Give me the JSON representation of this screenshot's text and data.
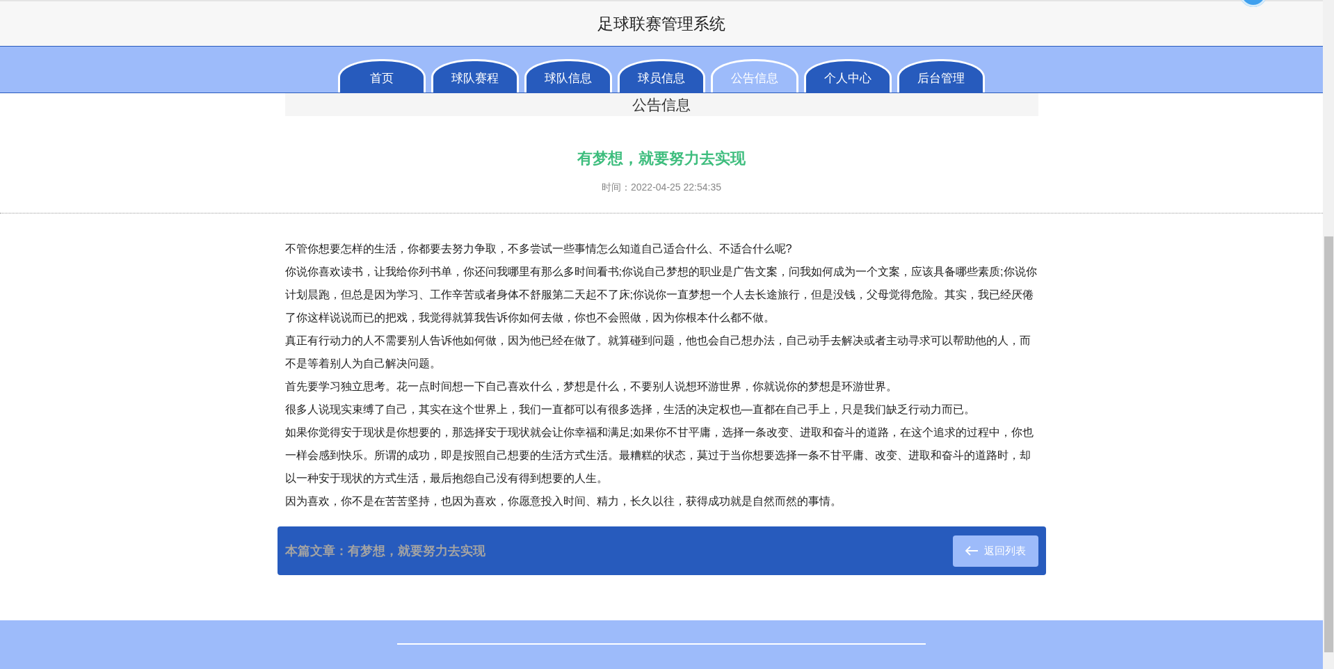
{
  "header": {
    "title": "足球联赛管理系统"
  },
  "nav": {
    "tabs": [
      {
        "label": "首页",
        "selected": false
      },
      {
        "label": "球队赛程",
        "selected": false
      },
      {
        "label": "球队信息",
        "selected": false
      },
      {
        "label": "球员信息",
        "selected": false
      },
      {
        "label": "公告信息",
        "selected": true
      },
      {
        "label": "个人中心",
        "selected": false
      },
      {
        "label": "后台管理",
        "selected": false
      }
    ]
  },
  "section": {
    "heading": "公告信息"
  },
  "article": {
    "title": "有梦想，就要努力去实现",
    "time": "时间：2022-04-25 22:54:35",
    "paragraphs": [
      "不管你想要怎样的生活，你都要去努力争取，不多尝试一些事情怎么知道自己适合什么、不适合什么呢?",
      "你说你喜欢读书，让我给你列书单，你还问我哪里有那么多时间看书;你说自己梦想的职业是广告文案，问我如何成为一个文案，应该具备哪些素质;你说你计划晨跑，但总是因为学习、工作辛苦或者身体不舒服第二天起不了床;你说你一直梦想一个人去长途旅行，但是没钱，父母觉得危险。其实，我已经厌倦了你这样说说而已的把戏，我觉得就算我告诉你如何去做，你也不会照做，因为你根本什么都不做。",
      "真正有行动力的人不需要别人告诉他如何做，因为他已经在做了。就算碰到问题，他也会自己想办法，自己动手去解决或者主动寻求可以帮助他的人，而不是等着别人为自己解决问题。",
      "首先要学习独立思考。花一点时间想一下自己喜欢什么，梦想是什么，不要别人说想环游世界，你就说你的梦想是环游世界。",
      "很多人说现实束缚了自己，其实在这个世界上，我们一直都可以有很多选择，生活的决定权也—直都在自己手上，只是我们缺乏行动力而已。",
      "如果你觉得安于现状是你想要的，那选择安于现状就会让你幸福和满足;如果你不甘平庸，选择一条改变、进取和奋斗的道路，在这个追求的过程中，你也一样会感到快乐。所谓的成功，即是按照自己想要的生活方式生活。最糟糕的状态，莫过于当你想要选择一条不甘平庸、改变、进取和奋斗的道路时，却以一种安于现状的方式生活，最后抱怨自己没有得到想要的人生。",
      "因为喜欢，你不是在苦苦坚持，也因为喜欢，你愿意投入时间、精力，长久以往，获得成功就是自然而然的事情。"
    ]
  },
  "article_bar": {
    "label": "本篇文章：有梦想，就要努力去实现",
    "button": "返回列表"
  }
}
